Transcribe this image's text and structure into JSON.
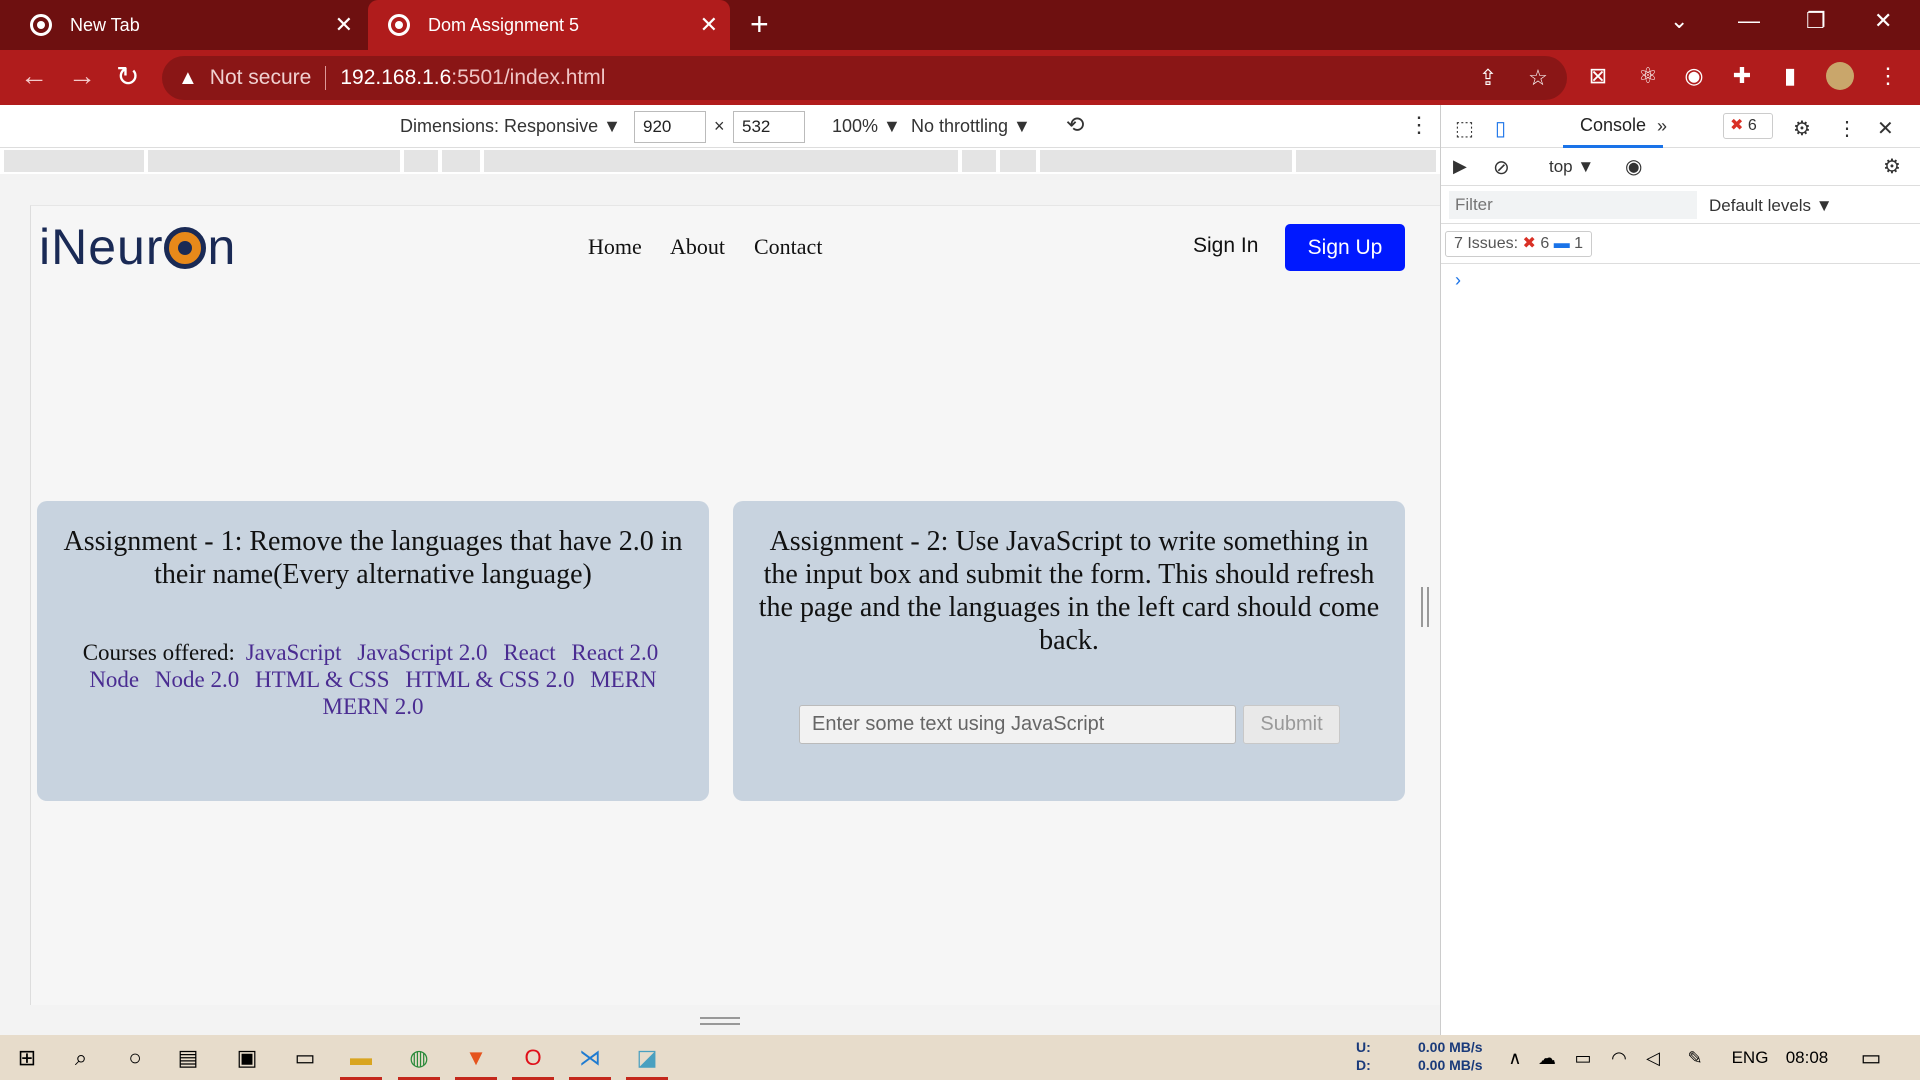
{
  "browser": {
    "tabs": [
      {
        "title": "New Tab"
      },
      {
        "title": "Dom Assignment 5"
      }
    ],
    "new_tab": "+",
    "address": {
      "security": "Not secure",
      "host": "192.168.1.6",
      "path": ":5501/index.html"
    }
  },
  "device_toolbar": {
    "dimensions_label": "Dimensions: Responsive ▼",
    "width": "920",
    "x": "×",
    "height": "532",
    "zoom": "100% ▼",
    "throttling": "No throttling ▼"
  },
  "page": {
    "logo": {
      "pre": "iNeur",
      "post": "n"
    },
    "nav": [
      "Home",
      "About",
      "Contact"
    ],
    "sign_in": "Sign In",
    "sign_up": "Sign Up",
    "card1": {
      "title": "Assignment - 1: Remove the languages that have 2.0 in their name(Every alternative language)",
      "courses_label": "Courses offered:",
      "languages": [
        "JavaScript",
        "JavaScript 2.0",
        "React",
        "React 2.0",
        "Node",
        "Node 2.0",
        "HTML & CSS",
        "HTML & CSS 2.0",
        "MERN",
        "MERN 2.0"
      ]
    },
    "card2": {
      "title": "Assignment - 2: Use JavaScript to write something in the input box and submit the form. This should refresh the page and the languages in the left card should come back.",
      "input_placeholder": "Enter some text using JavaScript",
      "submit": "Submit"
    }
  },
  "devtools": {
    "console_tab": "Console",
    "more": "»",
    "error_count": "6",
    "context": "top ▼",
    "filter_placeholder": "Filter",
    "levels": "Default levels ▼",
    "issues_label": "7 Issues:",
    "issues_errors": "6",
    "issues_info": "1",
    "prompt": "›"
  },
  "taskbar": {
    "net_labels": [
      "U:",
      "D:"
    ],
    "net_values": [
      "0.00 MB/s",
      "0.00 MB/s"
    ],
    "lang": "ENG",
    "time": "08:08"
  },
  "colors": {
    "tabstrip": "#6e1010",
    "toolbar": "#b01c1c",
    "signup": "#0019ff",
    "card": "#c8d3df",
    "link": "#4a2c91"
  }
}
